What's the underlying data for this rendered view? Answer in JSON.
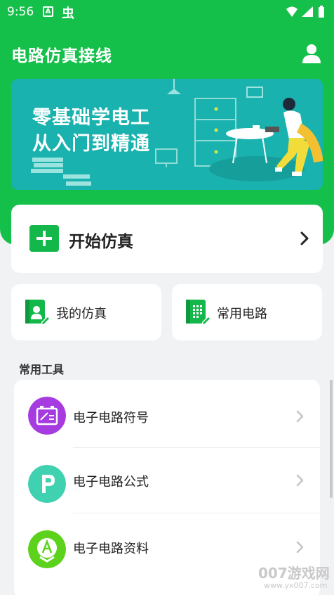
{
  "status_bar": {
    "time": "9:56",
    "notification_a": "A",
    "notification_glyph": "虫"
  },
  "header": {
    "title": "电路仿真接线"
  },
  "banner": {
    "line1": "零基础学电工",
    "line2": "从入门到精通"
  },
  "start_card": {
    "label": "开始仿真"
  },
  "quick_cards": [
    {
      "label": "我的仿真",
      "icon": "user-document-icon"
    },
    {
      "label": "常用电路",
      "icon": "circuit-document-icon"
    }
  ],
  "tools_section": {
    "title": "常用工具",
    "items": [
      {
        "label": "电子电路符号",
        "icon": "battery-symbol-icon",
        "color": "#a63ce0"
      },
      {
        "label": "电子电路公式",
        "icon": "letter-p-icon",
        "color": "#3fd1b0"
      },
      {
        "label": "电子电路资料",
        "icon": "letter-a-icon",
        "color": "#5dd21c"
      }
    ]
  },
  "watermark": {
    "brand": "007游戏网",
    "url": "www.yx007.com"
  },
  "colors": {
    "primary": "#14c04a",
    "banner": "#19b2ae",
    "background": "#f1f2f4"
  }
}
